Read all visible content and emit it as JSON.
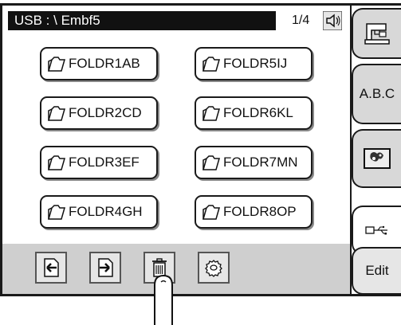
{
  "title_bar": {
    "path": "USB : \\ Embf5"
  },
  "page_indicator": "1/4",
  "folders": [
    "FOLDR1AB",
    "FOLDR5IJ",
    "FOLDR2CD",
    "FOLDR6KL",
    "FOLDR3EF",
    "FOLDR7MN",
    "FOLDR4GH",
    "FOLDR8OP"
  ],
  "toolbar": [
    {
      "icon": "arrow-left-icon"
    },
    {
      "icon": "arrow-right-icon"
    },
    {
      "icon": "trash-icon"
    },
    {
      "icon": "settings-gear-icon"
    }
  ],
  "side_tabs": {
    "machine": {
      "icon": "sewing-machine-icon"
    },
    "abc": "A.B.C",
    "embroidery": {
      "icon": "embroidery-design-icon"
    },
    "usb": {
      "icon": "usb-icon",
      "active": true
    },
    "edit": "Edit"
  },
  "colors": {
    "title_bar_bg": "#111111",
    "strip_bg": "#cfcfcf",
    "tab_bg": "#d8d8d8"
  }
}
